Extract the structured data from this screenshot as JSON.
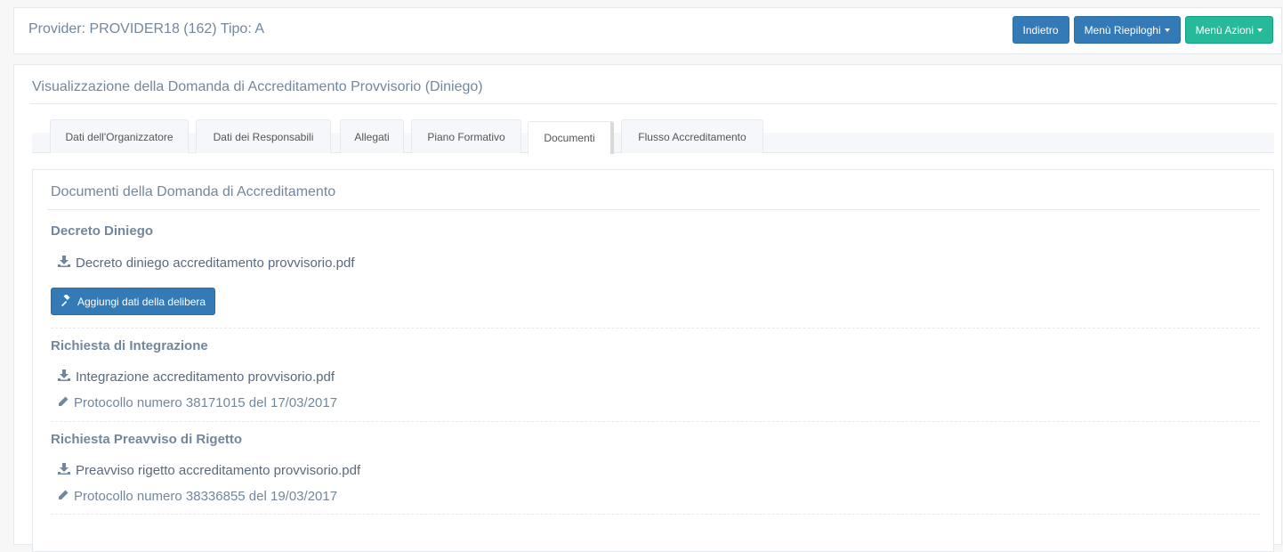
{
  "header": {
    "provider_title": "Provider: PROVIDER18 (162) Tipo: A",
    "buttons": {
      "back": "Indietro",
      "summary_menu": "Menù Riepiloghi",
      "actions_menu": "Menù Azioni"
    }
  },
  "main": {
    "title": "Visualizzazione della Domanda di Accreditamento Provvisorio (Diniego)",
    "tabs": [
      {
        "label": "Dati dell'Organizzatore"
      },
      {
        "label": "Dati dei Responsabili"
      },
      {
        "label": "Allegati"
      },
      {
        "label": "Piano Formativo"
      },
      {
        "label": "Documenti",
        "active": true
      },
      {
        "label": "Flusso Accreditamento"
      }
    ]
  },
  "documents": {
    "title": "Documenti della Domanda di Accreditamento",
    "sections": [
      {
        "heading": "Decreto Diniego",
        "file": "Decreto diniego accreditamento provvisorio.pdf",
        "action_button": "Aggiungi dati della delibera"
      },
      {
        "heading": "Richiesta di Integrazione",
        "file": "Integrazione accreditamento provvisorio.pdf",
        "protocol": "Protocollo numero 38171015 del 17/03/2017"
      },
      {
        "heading": "Richiesta Preavviso di Rigetto",
        "file": "Preavviso rigetto accreditamento provvisorio.pdf",
        "protocol": "Protocollo numero 38336855 del 19/03/2017"
      }
    ]
  },
  "colors": {
    "primary": "#337ab7",
    "success": "#26b99a",
    "text": "#73879c"
  },
  "icons": {
    "download": "download-icon",
    "pencil": "pencil-icon",
    "gavel": "gavel-icon",
    "caret": "caret-down-icon"
  }
}
